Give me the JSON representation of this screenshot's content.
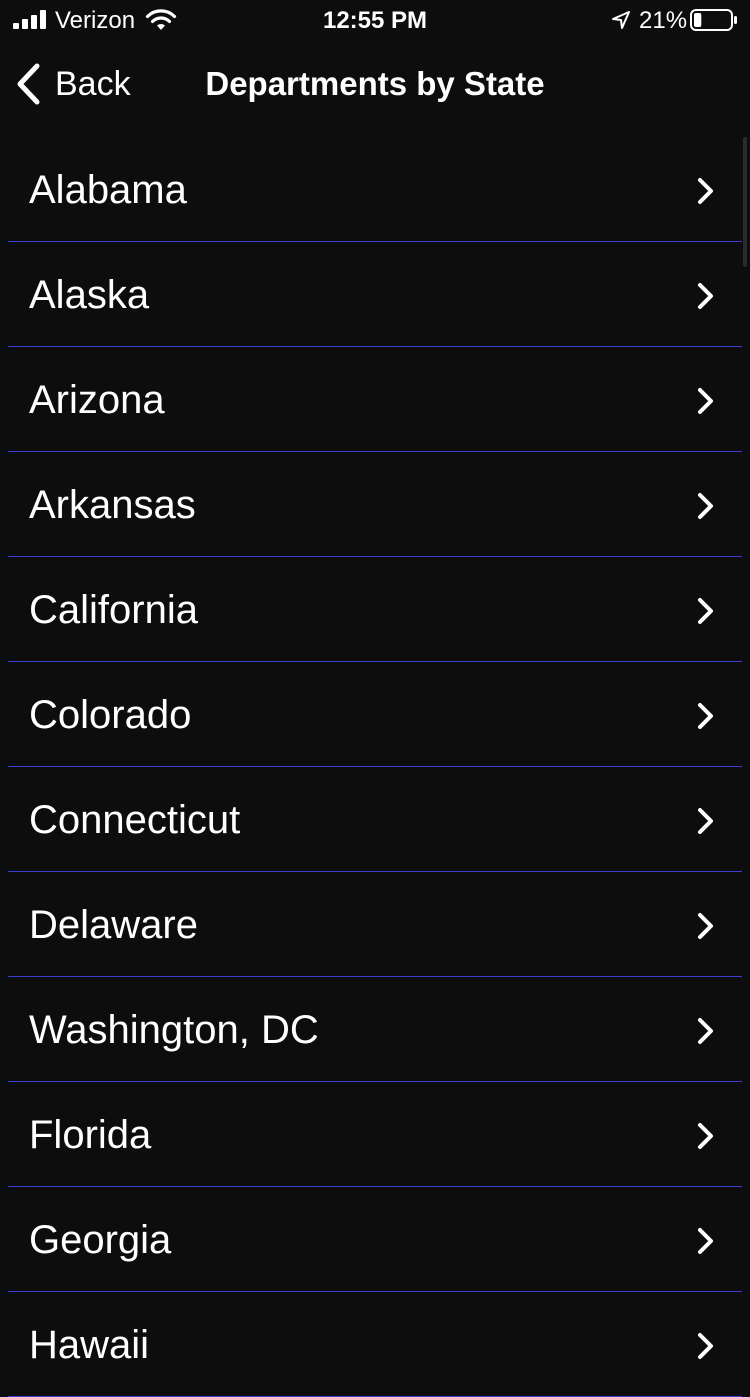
{
  "status_bar": {
    "carrier": "Verizon",
    "time": "12:55 PM",
    "battery_percent": "21%",
    "battery_level": 0.21,
    "icons": [
      "signal-bars-icon",
      "wifi-icon",
      "location-arrow-icon",
      "battery-icon"
    ]
  },
  "nav": {
    "back_label": "Back",
    "title": "Departments by State"
  },
  "states": [
    "Alabama",
    "Alaska",
    "Arizona",
    "Arkansas",
    "California",
    "Colorado",
    "Connecticut",
    "Delaware",
    "Washington, DC",
    "Florida",
    "Georgia",
    "Hawaii"
  ],
  "colors": {
    "background": "#0d0d0e",
    "text": "#ffffff",
    "separator": "#3a3fd6"
  }
}
